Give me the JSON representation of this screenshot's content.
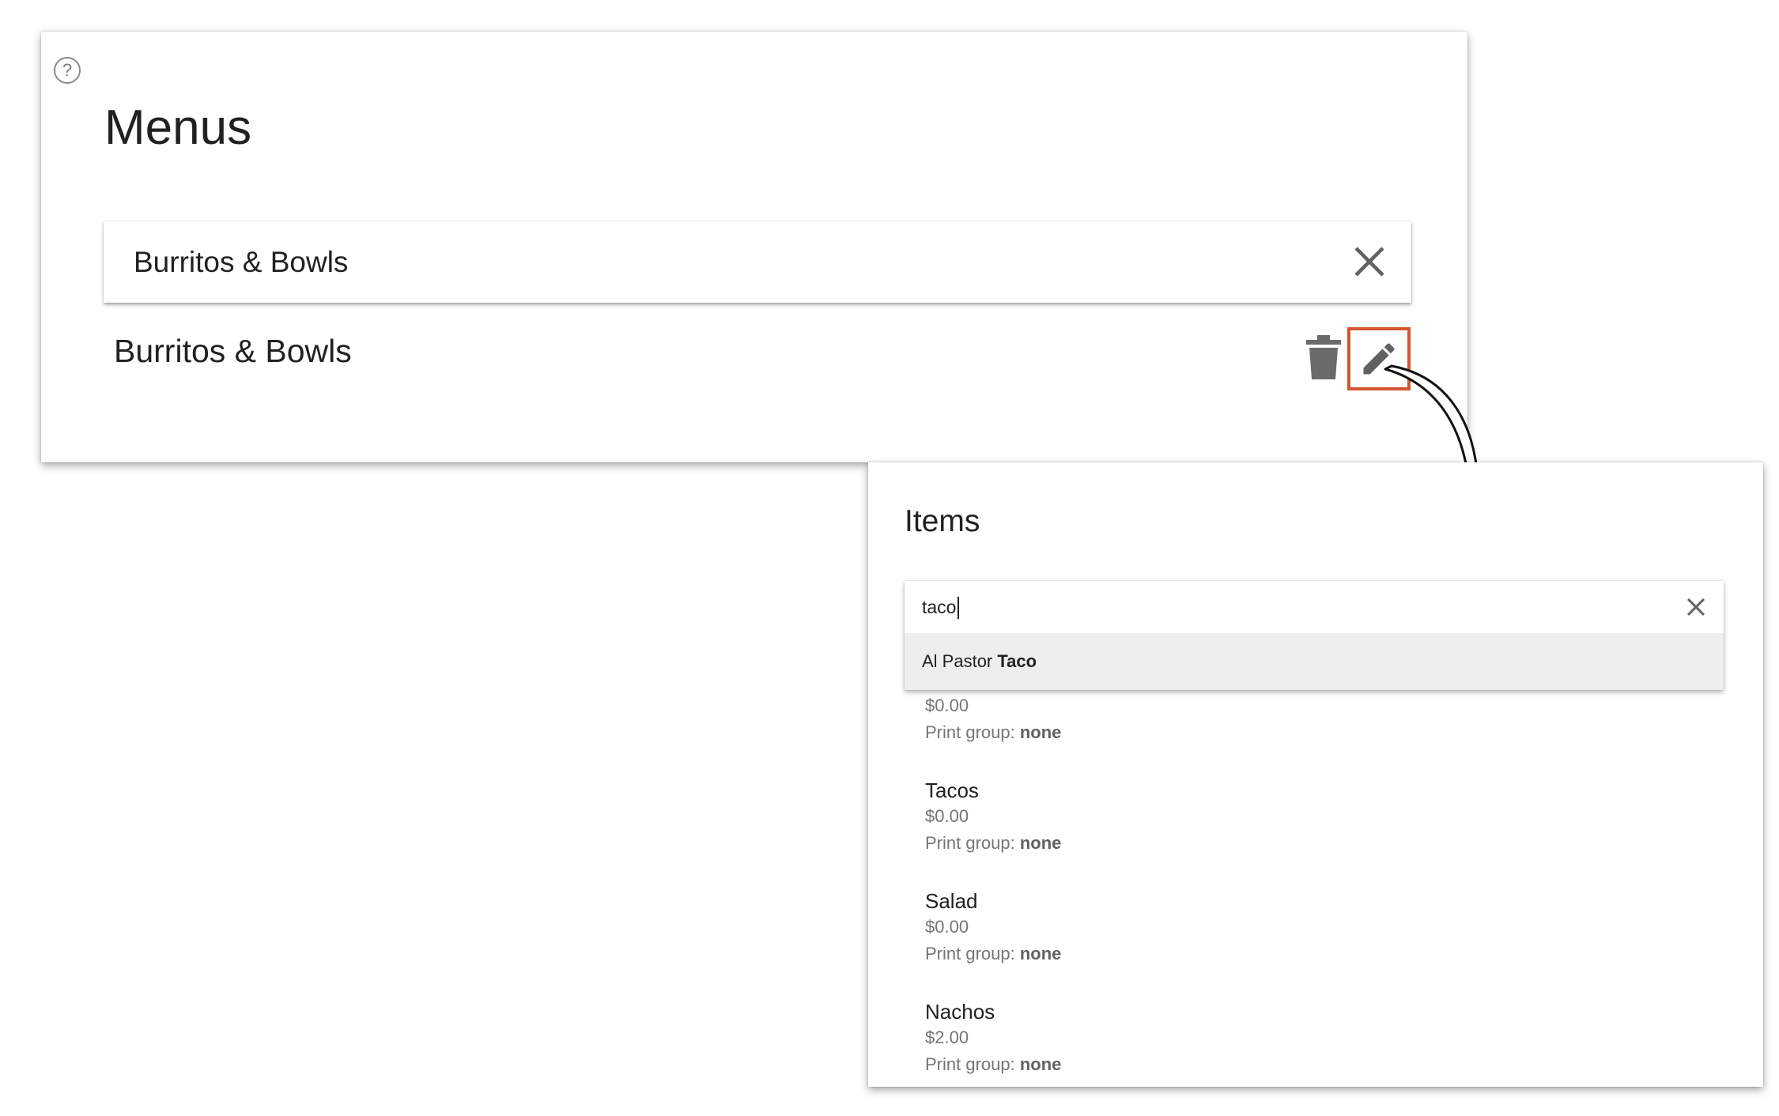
{
  "menus": {
    "title": "Menus",
    "help_icon": "?",
    "name_field_value": "Burritos & Bowls",
    "menu_row_label": "Burritos & Bowls",
    "icons": {
      "help": "help-circle-icon",
      "clear": "close-icon",
      "delete": "trash-icon",
      "edit": "pencil-icon"
    },
    "edit_highlight_color": "#d4562f"
  },
  "items": {
    "title": "Items",
    "search_value": "taco",
    "suggestion": {
      "prefix": "Al Pastor ",
      "match": "Taco"
    },
    "print_group_label": "Print group: ",
    "list": [
      {
        "name": "",
        "price": "$0.00",
        "print_group": "none"
      },
      {
        "name": "Tacos",
        "price": "$0.00",
        "print_group": "none"
      },
      {
        "name": "Salad",
        "price": "$0.00",
        "print_group": "none"
      },
      {
        "name": "Nachos",
        "price": "$2.00",
        "print_group": "none"
      }
    ]
  }
}
